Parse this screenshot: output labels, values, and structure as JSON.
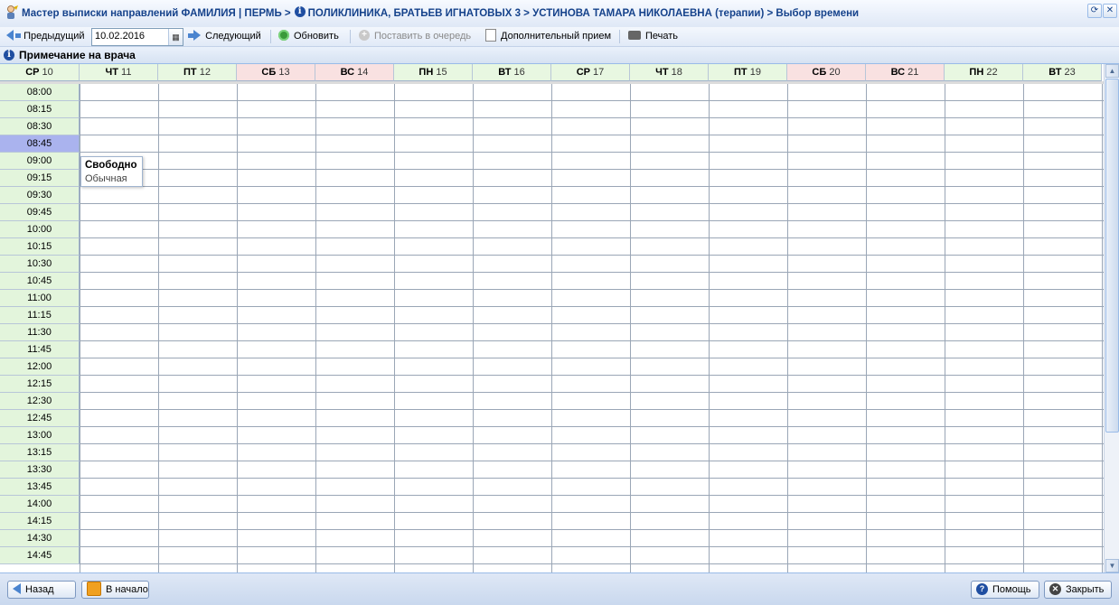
{
  "title": {
    "prefix": "Мастер выписки направлений ФАМИЛИЯ | ПЕРМЬ >",
    "clinic": "ПОЛИКЛИНИКА, БРАТЬЕВ ИГНАТОВЫХ 3 > УСТИНОВА ТАМАРА НИКОЛАЕВНА (терапии) > Выбор времени",
    "info_icon": "i"
  },
  "toolbar": {
    "prev_label": "Предыдущий",
    "date_value": "10.02.2016",
    "next_label": "Следующий",
    "refresh_label": "Обновить",
    "queue_label": "Поставить в очередь",
    "extra_label": "Дополнительный прием",
    "print_label": "Печать"
  },
  "note": {
    "icon": "i",
    "label": "Примечание на врача"
  },
  "days": [
    {
      "dow": "СР",
      "num": "10",
      "weekend": false
    },
    {
      "dow": "ЧТ",
      "num": "11",
      "weekend": false
    },
    {
      "dow": "ПТ",
      "num": "12",
      "weekend": false
    },
    {
      "dow": "СБ",
      "num": "13",
      "weekend": true
    },
    {
      "dow": "ВС",
      "num": "14",
      "weekend": true
    },
    {
      "dow": "ПН",
      "num": "15",
      "weekend": false
    },
    {
      "dow": "ВТ",
      "num": "16",
      "weekend": false
    },
    {
      "dow": "СР",
      "num": "17",
      "weekend": false
    },
    {
      "dow": "ЧТ",
      "num": "18",
      "weekend": false
    },
    {
      "dow": "ПТ",
      "num": "19",
      "weekend": false
    },
    {
      "dow": "СБ",
      "num": "20",
      "weekend": true
    },
    {
      "dow": "ВС",
      "num": "21",
      "weekend": true
    },
    {
      "dow": "ПН",
      "num": "22",
      "weekend": false
    },
    {
      "dow": "ВТ",
      "num": "23",
      "weekend": false
    }
  ],
  "slots": [
    "08:00",
    "08:15",
    "08:30",
    "08:45",
    "09:00",
    "09:15",
    "09:30",
    "09:45",
    "10:00",
    "10:15",
    "10:30",
    "10:45",
    "11:00",
    "11:15",
    "11:30",
    "11:45",
    "12:00",
    "12:15",
    "12:30",
    "12:45",
    "13:00",
    "13:15",
    "13:30",
    "13:45",
    "14:00",
    "14:15",
    "14:30",
    "14:45"
  ],
  "selected_slot": "08:45",
  "tooltip": {
    "status": "Свободно",
    "type": "Обычная"
  },
  "footer": {
    "back_label": "Назад",
    "home_label": "В начало",
    "help_label": "Помощь",
    "help_icon": "?",
    "close_label": "Закрыть",
    "close_icon": "✕"
  },
  "colors": {
    "weekday_header": "#e8f7e1",
    "weekend_header": "#f9e1e1",
    "time_column": "#e3f5dc",
    "selected_slot": "#aab3ee",
    "title_text": "#15428b"
  }
}
